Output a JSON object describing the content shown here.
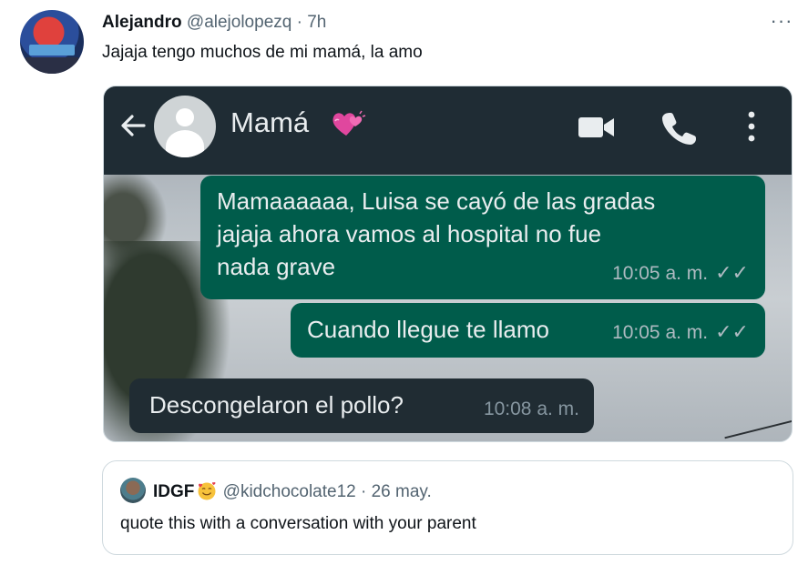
{
  "tweet": {
    "author_name": "Alejandro",
    "author_handle": "@alejolopezq",
    "separator": "·",
    "time": "7h",
    "more_label": "···",
    "text": "Jajaja tengo muchos de mi mamá, la amo"
  },
  "chat": {
    "contact_name": "Mamá",
    "icons": [
      "back-arrow-icon",
      "contact-avatar-icon",
      "hearts-emoji-icon",
      "video-call-icon",
      "phone-call-icon",
      "kebab-menu-icon"
    ],
    "colors": {
      "header_bg": "#1f2c34",
      "outgoing_bubble": "#005c4b",
      "incoming_bubble": "#202c33"
    },
    "messages": [
      {
        "direction": "out",
        "text": "Mamaaaaaa, Luisa se cayó de las gradas\njajaja ahora vamos al hospital no fue\nnada grave",
        "time": "10:05 a. m.",
        "ticks": "✓✓"
      },
      {
        "direction": "out",
        "text": "Cuando llegue te llamo",
        "time": "10:05 a. m.",
        "ticks": "✓✓"
      },
      {
        "direction": "in",
        "text": "Descongelaron el pollo?",
        "time": "10:08 a. m."
      }
    ]
  },
  "quoted": {
    "author_name": "IDGF",
    "emoji": "smiling-face-with-hearts-emoji",
    "author_handle": "@kidchocolate12",
    "separator": "·",
    "date": "26 may.",
    "text": "quote this with a conversation with your parent"
  }
}
